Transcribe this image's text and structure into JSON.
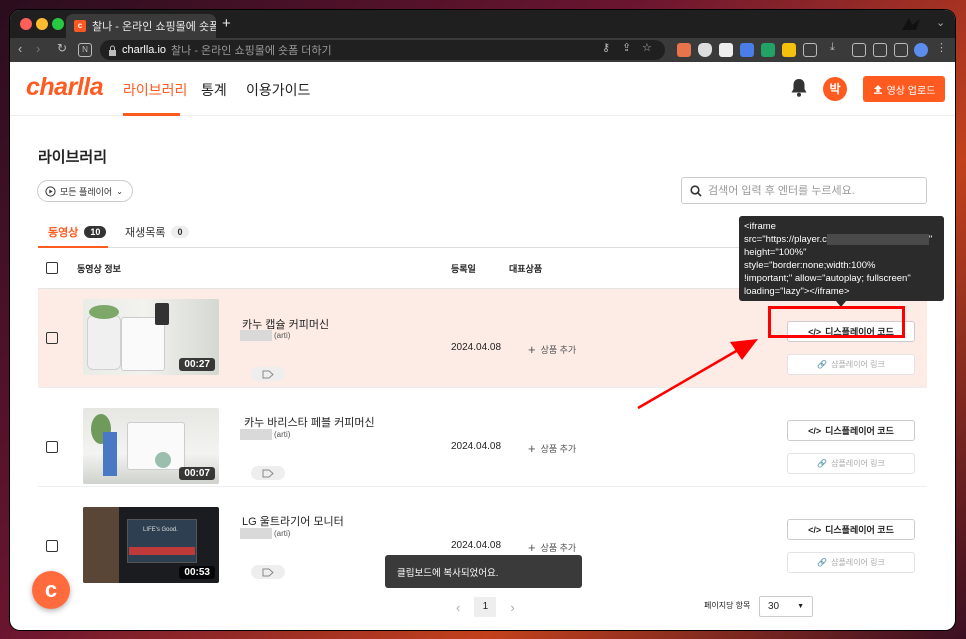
{
  "browser": {
    "tab_title": "찰나 - 온라인 쇼핑몰에 숏폼 더하기",
    "new_tab": "+",
    "url_domain": "charlla.io",
    "url_title": "찰나 - 온라인 쇼핑몰에 숏폼 더하기"
  },
  "app": {
    "logo": "charlla",
    "nav": [
      "라이브러리",
      "통계",
      "이용가이드"
    ],
    "avatar": "박",
    "upload_label": "영상 업로드"
  },
  "page": {
    "title": "라이브러리",
    "filter": "모든 플레이어",
    "search_placeholder": "검색어 입력 후 엔터를 누르세요.",
    "tabs": [
      {
        "label": "동영상",
        "count": "10"
      },
      {
        "label": "재생목록",
        "count": "0"
      }
    ],
    "columns": [
      "동영상 정보",
      "등록일",
      "대표상품"
    ]
  },
  "rows": [
    {
      "title": "카누 캡슐 커피머신",
      "author_suffix": "(arti)",
      "duration": "00:27",
      "date": "2024.04.08",
      "add_product": "상품 추가",
      "code_btn": "디스플레이어 코드",
      "link_btn": "샵플레이어 링크"
    },
    {
      "title": "카누 바리스타 페블 커피머신",
      "author_suffix": "(arti)",
      "duration": "00:07",
      "date": "2024.04.08",
      "add_product": "상품 추가",
      "code_btn": "디스플레이어 코드",
      "link_btn": "샵플레이어 링크"
    },
    {
      "title": "LG 울트라기어 모니터",
      "author_suffix": "(arti)",
      "duration": "00:53",
      "date": "2024.04.08",
      "add_product": "상품 추가",
      "code_btn": "디스플레이어 코드",
      "link_btn": "샵플레이어 링크"
    }
  ],
  "tooltip": {
    "line1": "<iframe",
    "line2a": "src=\"https://player.c",
    "line2b": "\"",
    "line3": "height=\"100%\"",
    "line4": "style=\"border:none;width:100%",
    "line5": "!important;\" allow=\"autoplay; fullscreen\"",
    "line6": "loading=\"lazy\"></iframe>"
  },
  "toast": "클립보드에 복사되었어요.",
  "pagination": {
    "prev": "‹",
    "current": "1",
    "next": "›",
    "per_page_label": "페이지당 항목",
    "per_page": "30"
  },
  "fab": "c",
  "colors": {
    "brand": "#ff5a1f",
    "highlight_row": "#fdece5",
    "annotation": "#ff0000"
  }
}
